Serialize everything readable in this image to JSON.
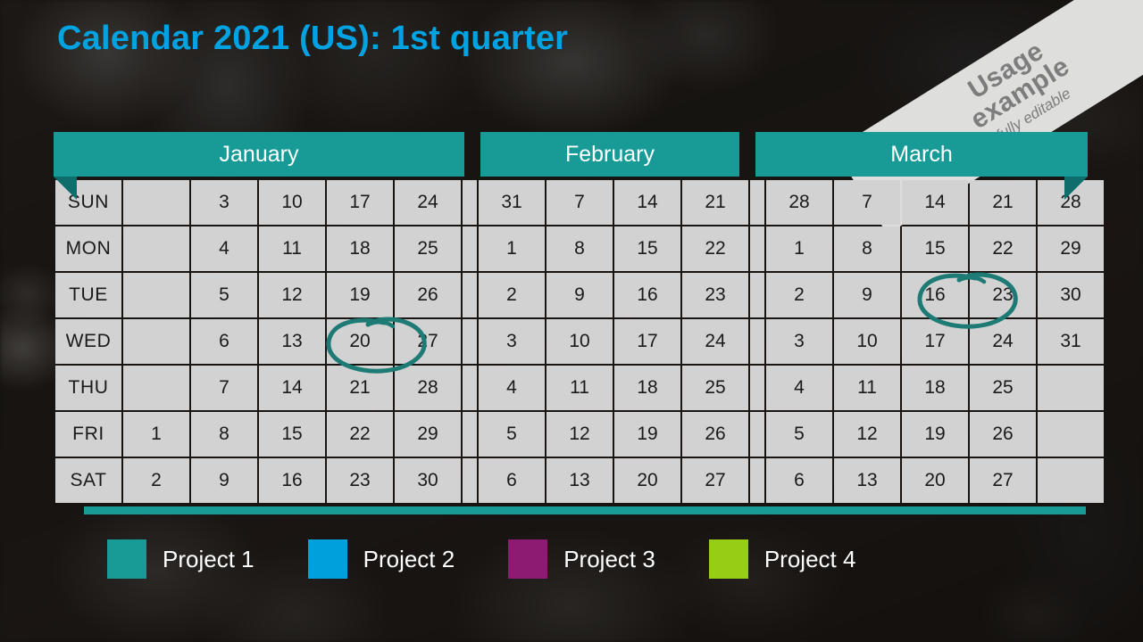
{
  "title": "Calendar 2021 (US): 1st quarter",
  "ribbon": {
    "line1": "Usage",
    "line2": "example",
    "line3": "fully editable"
  },
  "colors": {
    "title": "#00a2e2",
    "header_teal": "#189a97",
    "fold_teal": "#0f6d6b",
    "weekend_text": "#19a5e0",
    "cell_bg": "#d2d2d2",
    "spill_bg": "#c6c6c6",
    "dow_bg": "#46423e",
    "project1": "#189a97",
    "project2": "#00a0dd",
    "project3": "#8e1b72",
    "project4": "#97cd14",
    "annotation": "#1d7a74"
  },
  "months": [
    {
      "name": "January",
      "weeks": 5
    },
    {
      "name": "February",
      "weeks": 4
    },
    {
      "name": "March",
      "weeks": 5
    }
  ],
  "weekdays": [
    "SUN",
    "MON",
    "TUE",
    "WED",
    "THU",
    "FRI",
    "SAT"
  ],
  "grid": {
    "SUN": [
      {
        "d": "",
        "s": "empty"
      },
      {
        "d": "3",
        "s": "we"
      },
      {
        "d": "10",
        "s": "we"
      },
      {
        "d": "17",
        "s": "we"
      },
      {
        "d": "24",
        "s": "we"
      },
      {
        "d": "31",
        "s": "we spill"
      },
      {
        "d": "7",
        "s": "we"
      },
      {
        "d": "14",
        "s": "we"
      },
      {
        "d": "21",
        "s": "we"
      },
      {
        "d": "28",
        "s": "we spill"
      },
      {
        "d": "7",
        "s": "we"
      },
      {
        "d": "14",
        "s": "we"
      },
      {
        "d": "21",
        "s": "we"
      },
      {
        "d": "28",
        "s": "we"
      }
    ],
    "MON": [
      {
        "d": "",
        "s": "empty"
      },
      {
        "d": "4",
        "s": ""
      },
      {
        "d": "11",
        "s": ""
      },
      {
        "d": "18",
        "s": ""
      },
      {
        "d": "25",
        "s": ""
      },
      {
        "d": "1",
        "s": ""
      },
      {
        "d": "8",
        "s": ""
      },
      {
        "d": "15",
        "s": "p3"
      },
      {
        "d": "22",
        "s": "p3"
      },
      {
        "d": "1",
        "s": ""
      },
      {
        "d": "8",
        "s": "p4"
      },
      {
        "d": "15",
        "s": ""
      },
      {
        "d": "22",
        "s": ""
      },
      {
        "d": "29",
        "s": ""
      }
    ],
    "TUE": [
      {
        "d": "",
        "s": "empty"
      },
      {
        "d": "5",
        "s": "p1"
      },
      {
        "d": "12",
        "s": ""
      },
      {
        "d": "19",
        "s": ""
      },
      {
        "d": "26",
        "s": ""
      },
      {
        "d": "2",
        "s": ""
      },
      {
        "d": "9",
        "s": ""
      },
      {
        "d": "16",
        "s": "p3"
      },
      {
        "d": "23",
        "s": "p3"
      },
      {
        "d": "2",
        "s": ""
      },
      {
        "d": "9",
        "s": "p4"
      },
      {
        "d": "16",
        "s": ""
      },
      {
        "d": "23",
        "s": ""
      },
      {
        "d": "30",
        "s": ""
      }
    ],
    "WED": [
      {
        "d": "",
        "s": "empty"
      },
      {
        "d": "6",
        "s": "p1"
      },
      {
        "d": "13",
        "s": ""
      },
      {
        "d": "20",
        "s": "p2"
      },
      {
        "d": "27",
        "s": ""
      },
      {
        "d": "3",
        "s": ""
      },
      {
        "d": "10",
        "s": ""
      },
      {
        "d": "17",
        "s": "p3"
      },
      {
        "d": "24",
        "s": ""
      },
      {
        "d": "3",
        "s": ""
      },
      {
        "d": "10",
        "s": "p4"
      },
      {
        "d": "17",
        "s": ""
      },
      {
        "d": "24",
        "s": ""
      },
      {
        "d": "31",
        "s": ""
      }
    ],
    "THU": [
      {
        "d": "",
        "s": "empty"
      },
      {
        "d": "7",
        "s": "p1"
      },
      {
        "d": "14",
        "s": ""
      },
      {
        "d": "21",
        "s": "p2"
      },
      {
        "d": "28",
        "s": ""
      },
      {
        "d": "4",
        "s": ""
      },
      {
        "d": "11",
        "s": ""
      },
      {
        "d": "18",
        "s": "p3"
      },
      {
        "d": "25",
        "s": ""
      },
      {
        "d": "4",
        "s": ""
      },
      {
        "d": "11",
        "s": "p4"
      },
      {
        "d": "18",
        "s": ""
      },
      {
        "d": "25",
        "s": ""
      },
      {
        "d": "",
        "s": "empty"
      }
    ],
    "FRI": [
      {
        "d": "1",
        "s": ""
      },
      {
        "d": "8",
        "s": "p1"
      },
      {
        "d": "15",
        "s": ""
      },
      {
        "d": "22",
        "s": "p2"
      },
      {
        "d": "29",
        "s": ""
      },
      {
        "d": "5",
        "s": ""
      },
      {
        "d": "12",
        "s": ""
      },
      {
        "d": "19",
        "s": "p3"
      },
      {
        "d": "26",
        "s": ""
      },
      {
        "d": "5",
        "s": ""
      },
      {
        "d": "12",
        "s": "p4"
      },
      {
        "d": "19",
        "s": ""
      },
      {
        "d": "26",
        "s": ""
      },
      {
        "d": "",
        "s": "empty"
      }
    ],
    "SAT": [
      {
        "d": "2",
        "s": "we"
      },
      {
        "d": "9",
        "s": "we"
      },
      {
        "d": "16",
        "s": "we"
      },
      {
        "d": "23",
        "s": "we"
      },
      {
        "d": "30",
        "s": "we"
      },
      {
        "d": "6",
        "s": "we"
      },
      {
        "d": "13",
        "s": "we"
      },
      {
        "d": "20",
        "s": "we"
      },
      {
        "d": "27",
        "s": "we"
      },
      {
        "d": "6",
        "s": "we"
      },
      {
        "d": "13",
        "s": "we"
      },
      {
        "d": "20",
        "s": "we"
      },
      {
        "d": "27",
        "s": "we"
      },
      {
        "d": "",
        "s": "empty"
      }
    ]
  },
  "annotations": [
    {
      "name": "circle-jan-20",
      "day": "20",
      "month": "January"
    },
    {
      "name": "circle-mar-23",
      "day": "23",
      "month": "March"
    }
  ],
  "legend": [
    {
      "label": "Project 1",
      "color": "#189a97"
    },
    {
      "label": "Project 2",
      "color": "#00a0dd"
    },
    {
      "label": "Project 3",
      "color": "#8e1b72"
    },
    {
      "label": "Project 4",
      "color": "#97cd14"
    }
  ]
}
